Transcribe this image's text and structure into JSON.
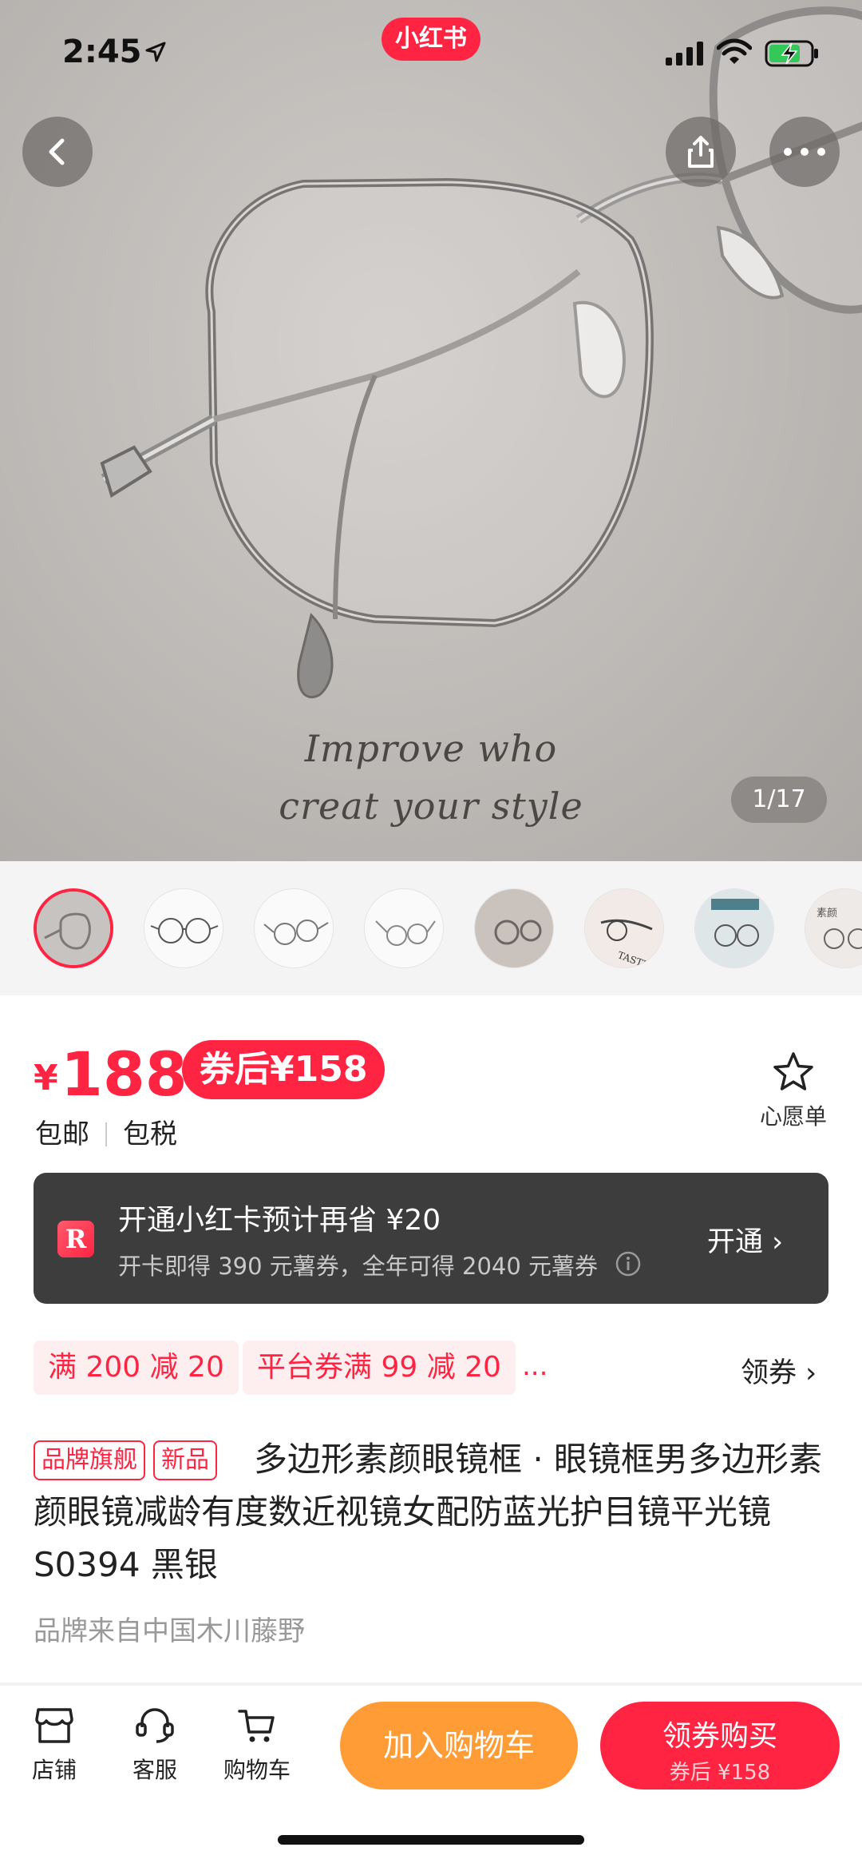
{
  "status_bar": {
    "time": "2:45"
  },
  "app": {
    "badge": "小红书"
  },
  "hero": {
    "caption_line1": "Improve who",
    "caption_line2": "creat your style",
    "page_counter": "1/17"
  },
  "thumbnails": [
    {
      "name": "thumb-1",
      "selected": true
    },
    {
      "name": "thumb-2"
    },
    {
      "name": "thumb-3"
    },
    {
      "name": "thumb-4"
    },
    {
      "name": "thumb-5"
    },
    {
      "name": "thumb-6",
      "text": "TASTE"
    },
    {
      "name": "thumb-7"
    },
    {
      "name": "thumb-8",
      "text": "素颜"
    }
  ],
  "price": {
    "currency": "¥",
    "amount": "188",
    "after_coupon": "券后¥158"
  },
  "shipping": {
    "free_shipping": "包邮",
    "tax_included": "包税"
  },
  "wishlist": {
    "label": "心愿单",
    "icon": "star-icon"
  },
  "member_card": {
    "logo": "R",
    "title": "开通小红卡预计再省 ¥20",
    "subtitle": "开卡即得 390 元薯券，全年可得 2040 元薯券",
    "cta": "开通 ›"
  },
  "coupons": {
    "items": [
      "满 200 减 20",
      "平台券满 99 减 20"
    ],
    "more": "...",
    "get_label": "领券 ›"
  },
  "product": {
    "tags": [
      "品牌旗舰",
      "新品"
    ],
    "title": "多边形素颜眼镜框 · 眼镜框男多边形素颜眼镜减龄有度数近视镜女配防蓝光护目镜平光镜 S0394  黑银",
    "brand_origin": "品牌来自中国木川藤野"
  },
  "bottom_nav": {
    "shop": "店铺",
    "service": "客服",
    "cart": "购物车",
    "add_to_cart": "加入购物车",
    "buy_main": "领券购买",
    "buy_sub": "券后 ¥158"
  },
  "colors": {
    "brand_red": "#ff2442",
    "orange": "#ff9c35",
    "member_card_bg": "#3d3d3d",
    "coupon_bg": "#fdeff0"
  }
}
